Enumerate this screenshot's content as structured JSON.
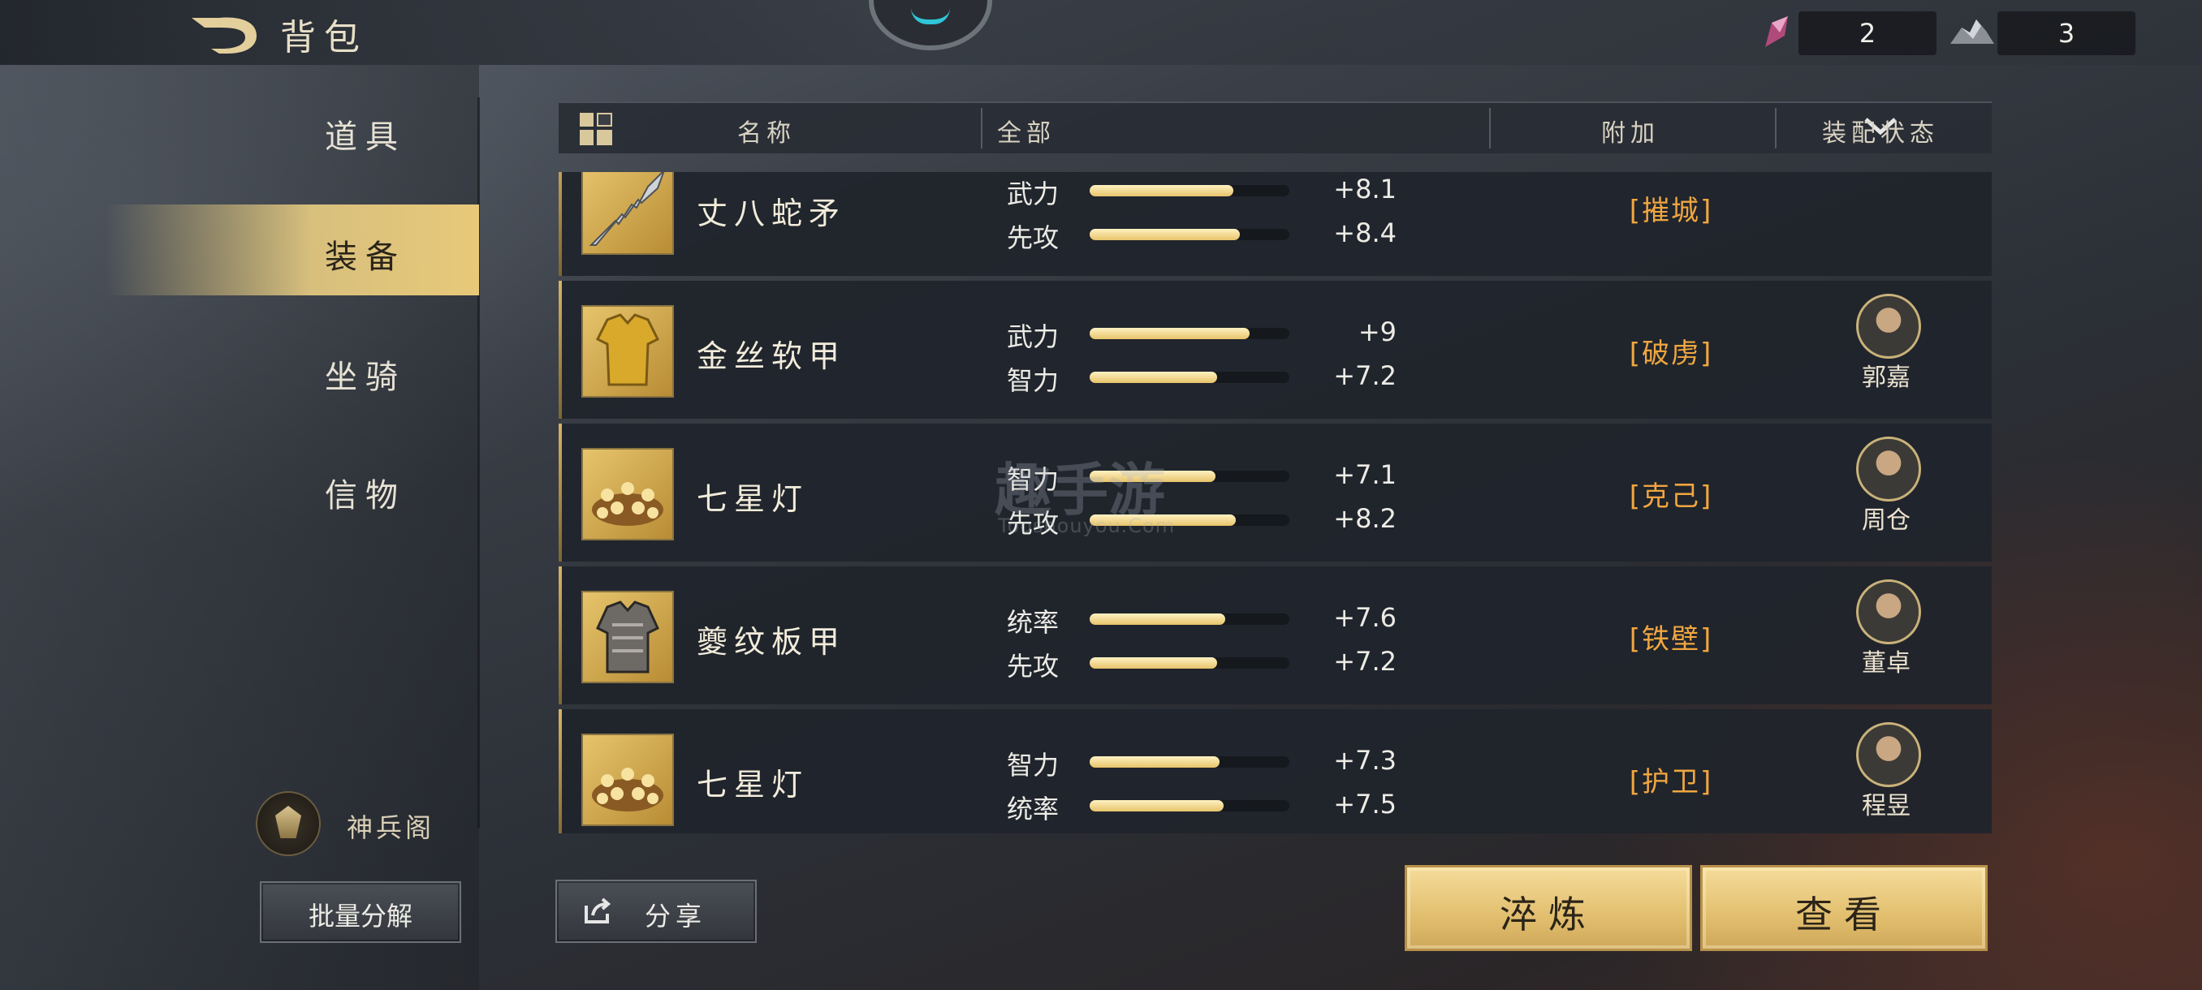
{
  "header": {
    "title": "背包",
    "resources": [
      {
        "icon": "crystal-icon",
        "value": "2"
      },
      {
        "icon": "ore-icon",
        "value": "3"
      }
    ]
  },
  "sidebar": {
    "tabs": [
      {
        "label": "道具",
        "active": false
      },
      {
        "label": "装备",
        "active": true
      },
      {
        "label": "坐骑",
        "active": false
      },
      {
        "label": "信物",
        "active": false
      }
    ],
    "armory_label": "神兵阁",
    "batch_label": "批量分解"
  },
  "table": {
    "col_name": "名称",
    "filter_value": "全部",
    "col_bonus": "附加",
    "col_status": "装配状态"
  },
  "items": [
    {
      "name": "丈八蛇矛",
      "icon": "spear-icon",
      "stats": [
        {
          "label": "武力",
          "value": "+8.1",
          "fill": 0.72
        },
        {
          "label": "先攻",
          "value": "+8.4",
          "fill": 0.75
        }
      ],
      "bonus": "[摧城]",
      "hero": null
    },
    {
      "name": "金丝软甲",
      "icon": "gold-armor-icon",
      "stats": [
        {
          "label": "武力",
          "value": "+9",
          "fill": 0.8
        },
        {
          "label": "智力",
          "value": "+7.2",
          "fill": 0.64
        }
      ],
      "bonus": "[破虏]",
      "hero": "郭嘉"
    },
    {
      "name": "七星灯",
      "icon": "seven-star-lamp-icon",
      "stats": [
        {
          "label": "智力",
          "value": "+7.1",
          "fill": 0.63
        },
        {
          "label": "先攻",
          "value": "+8.2",
          "fill": 0.73
        }
      ],
      "bonus": "[克己]",
      "hero": "周仓"
    },
    {
      "name": "夔纹板甲",
      "icon": "plate-armor-icon",
      "stats": [
        {
          "label": "统率",
          "value": "+7.6",
          "fill": 0.68
        },
        {
          "label": "先攻",
          "value": "+7.2",
          "fill": 0.64
        }
      ],
      "bonus": "[铁壁]",
      "hero": "董卓"
    },
    {
      "name": "七星灯",
      "icon": "seven-star-lamp-icon",
      "stats": [
        {
          "label": "智力",
          "value": "+7.3",
          "fill": 0.65
        },
        {
          "label": "统率",
          "value": "+7.5",
          "fill": 0.67
        }
      ],
      "bonus": "[护卫]",
      "hero": "程昱"
    }
  ],
  "actions": {
    "share_label": "分享",
    "refine_label": "淬炼",
    "view_label": "查看"
  },
  "watermark": {
    "main": "趣手游",
    "sub": "Tooshouyou.Com"
  },
  "colors": {
    "gold": "#e8c97a",
    "bonus_orange": "#f0a640",
    "panel": "#20242b"
  }
}
